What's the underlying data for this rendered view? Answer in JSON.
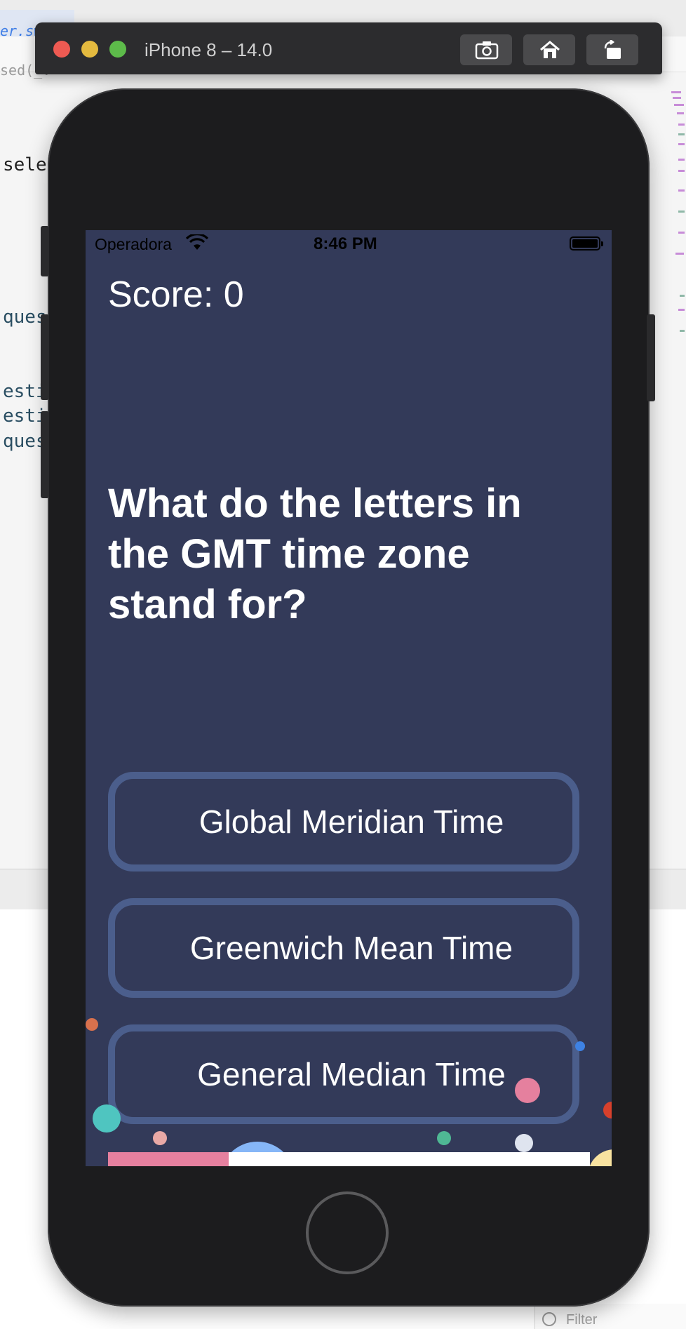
{
  "editor": {
    "tab_fragment": "er.sw",
    "crumb_fragment": "sed(_:",
    "code_lines": [
      "sele",
      "ques",
      "estic",
      "estic",
      "quest"
    ],
    "filter_placeholder": "Filter"
  },
  "simulator": {
    "title": "iPhone 8 – 14.0",
    "buttons": [
      "screenshot-icon",
      "home-icon",
      "rotate-icon"
    ]
  },
  "status_bar": {
    "carrier": "Operadora",
    "time": "8:46 PM"
  },
  "quiz": {
    "score_label": "Score: 0",
    "question": "What do the letters in the GMT time zone stand for?",
    "answers": [
      "Global Meridian Time",
      "Greenwich Mean Time",
      "General Median Time"
    ],
    "progress": 0.25
  },
  "colors": {
    "screen_background": "#333a59",
    "answer_border": "#4b5e8c",
    "progress_fill": "#e6809f"
  }
}
